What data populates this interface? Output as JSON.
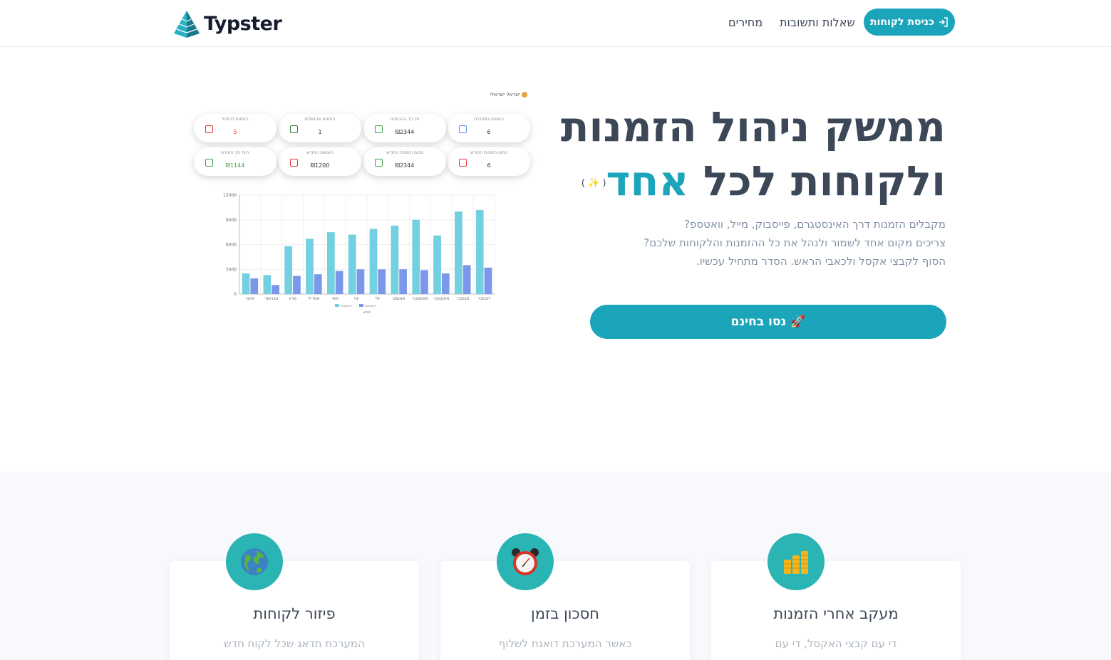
{
  "brand": {
    "name": "Typster"
  },
  "nav": {
    "login_label": "כניסת לקוחות",
    "links": [
      "שאלות ותשובות",
      "מחירים"
    ]
  },
  "hero": {
    "title_line1": "ממשק ניהול הזמנות",
    "title_line2_main": "ולקוחות לכל",
    "title_line2_accent": "אחד",
    "sparkle": "( ✨ )",
    "desc_lines": [
      "מקבלים הזמנות דרך האינסטגרם, פייסבוק, מייל, וואטספ?",
      "צריכים מקום אחד לשמור ולנהל את כל ההזמנות והלקוחות שלכם?",
      "הסוף לקבצי אקסל ולכאבי הראש. הסדר מתחיל עכשיו."
    ],
    "cta_label": "נסו בחינם 🚀"
  },
  "preview": {
    "user": "ישראל ישראלי",
    "stats": [
      {
        "label": "הזמנות במערכת",
        "value": "6",
        "icon": "checklist-icon",
        "color": "#5b8def"
      },
      {
        "label": "סך כל ההכנסות",
        "value": "₪2344",
        "icon": "money-icon",
        "color": "#43a047"
      },
      {
        "label": "הזמנות שהושלמו",
        "value": "1",
        "icon": "check-icon",
        "color": "#2e7d32"
      },
      {
        "label": "הזמנות לטיפול",
        "value": "5",
        "icon": "calendar-icon",
        "color": "#e53935",
        "value_color": "#e53935"
      },
      {
        "label": "כמות הזמנות החודש",
        "value": "6",
        "icon": "calendar-icon",
        "color": "#e53935"
      },
      {
        "label": "סכום הזמנות החודש",
        "value": "₪2344",
        "icon": "basket-icon",
        "color": "#43a047"
      },
      {
        "label": "הוצאות החודש",
        "value": "₪1200",
        "icon": "down-chart-icon",
        "color": "#e53935"
      },
      {
        "label": "רווח נקי החודש",
        "value": "₪1144",
        "icon": "up-chart-icon",
        "color": "#43a047",
        "value_color": "#43a047"
      }
    ]
  },
  "chart_data": {
    "type": "bar",
    "categories": [
      "ינואר",
      "פברואר",
      "מרץ",
      "אפריל",
      "מאי",
      "יוני",
      "יולי",
      "אוגוסט",
      "ספטמבר",
      "אוקטובר",
      "נובמבר",
      "דצמבר"
    ],
    "series": [
      {
        "name": "הכנסות",
        "color": "#72d0e0",
        "values": [
          2500,
          2300,
          5800,
          6700,
          7500,
          7200,
          7900,
          8300,
          9000,
          7100,
          10000,
          10200
        ]
      },
      {
        "name": "הוצאות",
        "color": "#7b97ea",
        "values": [
          1900,
          1100,
          2200,
          2400,
          2800,
          3000,
          3000,
          3000,
          2900,
          2500,
          3500,
          3200
        ]
      }
    ],
    "ylim": [
      0,
      12000
    ],
    "yticks": [
      "0",
      "3000",
      "6000",
      "9000",
      "12000"
    ],
    "xlabel": "חודש",
    "grid": true,
    "legend": "bottom"
  },
  "features": [
    {
      "title": "מעקב אחרי הזמנות",
      "text": "די עם קבצי האקסל, די עם",
      "icon": "coins-icon"
    },
    {
      "title": "חסכון בזמן",
      "text": "כאשר המערכת דואגת לשלוף",
      "icon": "alarm-clock-icon"
    },
    {
      "title": "פיזור לקוחות",
      "text": "המערכת תדאג שכל לקוח חדש",
      "icon": "globe-icon"
    }
  ]
}
